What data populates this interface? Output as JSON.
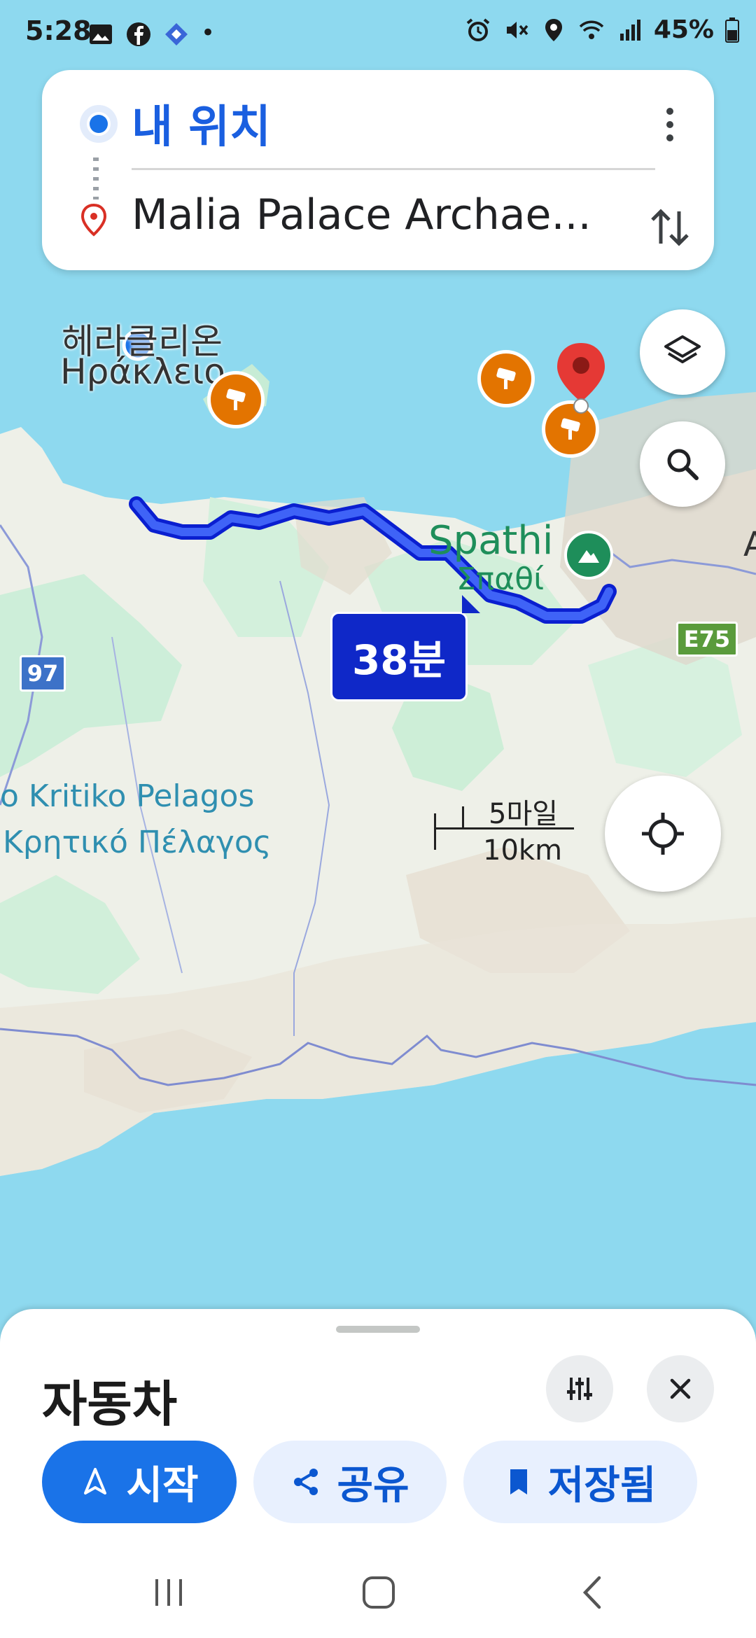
{
  "status_bar": {
    "time": "5:28",
    "battery": "45%"
  },
  "route": {
    "origin": "내 위치",
    "destination": "Malia Palace Archae..."
  },
  "map": {
    "labels": {
      "city_ko": "헤라클리온",
      "city_gr": "Ηράκλειο",
      "mountain_en": "Spathi",
      "mountain_gr": "Σπαθί",
      "sea_en": "o Kritiko Pelagos",
      "sea_gr": "Κρητικό Πέλαγος",
      "road_97": "97",
      "road_e75": "E75",
      "edge_letter": "A"
    },
    "route_time": "38분",
    "scale": {
      "miles": "5마일",
      "km": "10km"
    }
  },
  "sheet": {
    "mode_title": "자동차",
    "start_label": "시작",
    "share_label": "공유",
    "saved_label": "저장됨"
  },
  "colors": {
    "water": "#8ed9ef",
    "land": "#eef0e8",
    "route": "#1f3fe0",
    "primary_button": "#1a73e8",
    "secondary_button": "#e8f0fe"
  },
  "icons": [
    "gallery-icon",
    "facebook-icon",
    "app-icon",
    "alarm-icon",
    "mute-icon",
    "location-icon",
    "wifi-icon",
    "signal-icon",
    "battery-icon",
    "more-vert-icon",
    "swap-icon",
    "layers-icon",
    "search-icon",
    "my-location-icon",
    "speed-camera-icon",
    "destination-pin-icon",
    "mountain-icon",
    "tune-icon",
    "close-icon",
    "navigation-icon",
    "share-icon",
    "bookmark-icon"
  ]
}
